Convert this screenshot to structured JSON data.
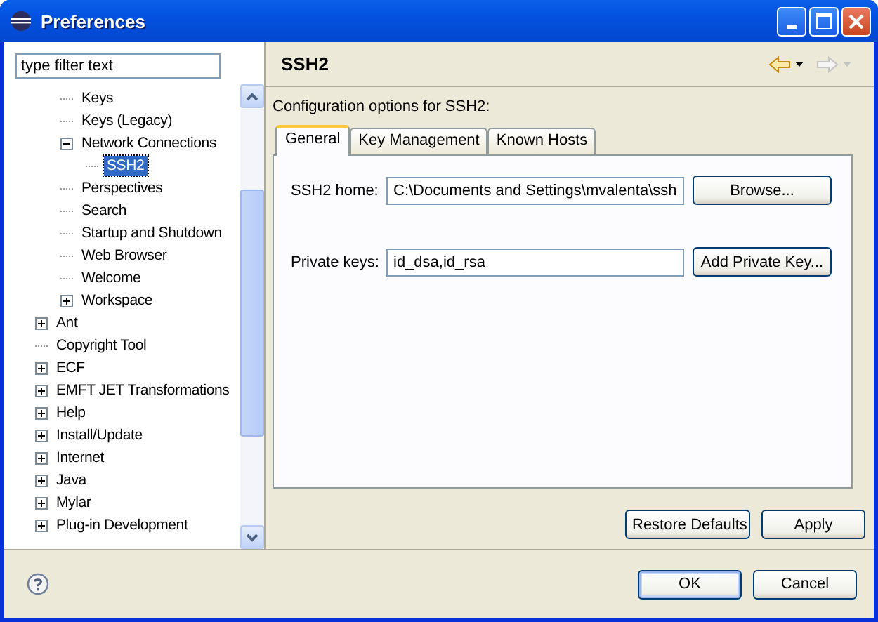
{
  "window": {
    "title": "Preferences"
  },
  "filter": {
    "value": "type filter text"
  },
  "tree": {
    "continued_children": [
      {
        "label": "Keys",
        "kind": "leaf",
        "selected": false
      },
      {
        "label": "Keys (Legacy)",
        "kind": "leaf",
        "selected": false
      },
      {
        "label": "Network Connections",
        "kind": "folder",
        "expanded": true,
        "selected": false,
        "children": [
          {
            "label": "SSH2",
            "kind": "leaf",
            "selected": true
          }
        ]
      },
      {
        "label": "Perspectives",
        "kind": "leaf",
        "selected": false
      },
      {
        "label": "Search",
        "kind": "leaf",
        "selected": false
      },
      {
        "label": "Startup and Shutdown",
        "kind": "leaf",
        "selected": false
      },
      {
        "label": "Web Browser",
        "kind": "leaf",
        "selected": false
      },
      {
        "label": "Welcome",
        "kind": "leaf",
        "selected": false
      },
      {
        "label": "Workspace",
        "kind": "folder",
        "expanded": false,
        "selected": false
      }
    ],
    "items": [
      {
        "label": "Ant",
        "kind": "folder",
        "expanded": false,
        "selected": false
      },
      {
        "label": "Copyright Tool",
        "kind": "leaf",
        "selected": false
      },
      {
        "label": "ECF",
        "kind": "folder",
        "expanded": false,
        "selected": false
      },
      {
        "label": "EMFT JET Transformations",
        "kind": "folder",
        "expanded": false,
        "selected": false
      },
      {
        "label": "Help",
        "kind": "folder",
        "expanded": false,
        "selected": false
      },
      {
        "label": "Install/Update",
        "kind": "folder",
        "expanded": false,
        "selected": false
      },
      {
        "label": "Internet",
        "kind": "folder",
        "expanded": false,
        "selected": false
      },
      {
        "label": "Java",
        "kind": "folder",
        "expanded": false,
        "selected": false
      },
      {
        "label": "Mylar",
        "kind": "folder",
        "expanded": false,
        "selected": false
      },
      {
        "label": "Plug-in Development",
        "kind": "folder",
        "expanded": false,
        "selected": false
      }
    ]
  },
  "page": {
    "title": "SSH2",
    "nav": [
      {
        "kind": "back",
        "disabled": false
      },
      {
        "kind": "forward",
        "disabled": true
      }
    ],
    "description": "Configuration options for SSH2:",
    "tabs": [
      {
        "label": "General",
        "selected": true
      },
      {
        "label": "Key Management",
        "selected": false
      },
      {
        "label": "Known Hosts",
        "selected": false
      }
    ],
    "fields": [
      {
        "label": "SSH2 home:",
        "value": "C:\\Documents and Settings\\mvalenta\\ssh",
        "button": "Browse..."
      },
      {
        "label": "Private keys:",
        "value": "id_dsa,id_rsa",
        "button": "Add Private Key..."
      }
    ],
    "buttons": [
      "Restore Defaults",
      "Apply"
    ]
  },
  "dialog_buttons": [
    {
      "label": "OK",
      "default": true
    },
    {
      "label": "Cancel",
      "default": false
    }
  ]
}
